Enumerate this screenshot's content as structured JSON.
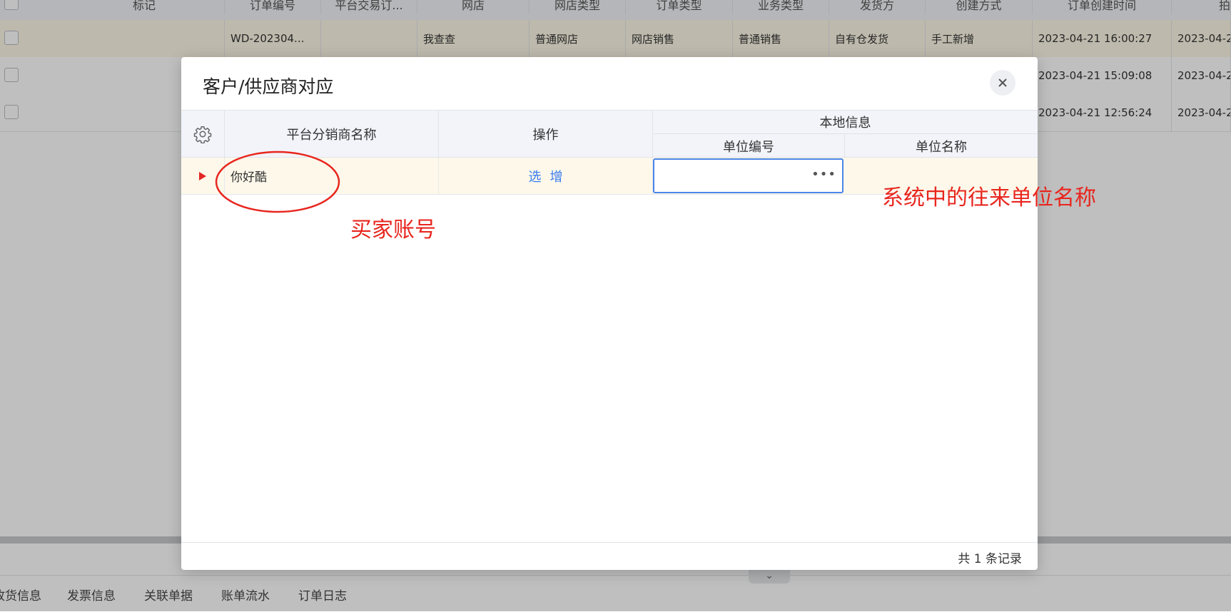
{
  "background": {
    "columns": [
      "标记",
      "订单编号",
      "平台交易订...",
      "网店",
      "网店类型",
      "订单类型",
      "业务类型",
      "发货方",
      "创建方式",
      "订单创建时间",
      "拍"
    ],
    "rows": [
      {
        "order_no": "WD-202304...",
        "platform_no": "",
        "shop": "我查查",
        "shop_type": "普通网店",
        "order_type": "网店销售",
        "biz_type": "普通销售",
        "shipper": "自有仓发货",
        "create_method": "手工新增",
        "created_at": "2023-04-21 16:00:27",
        "extra": "2023-04-2"
      },
      {
        "order_no": "",
        "platform_no": "",
        "shop": "",
        "shop_type": "",
        "order_type": "",
        "biz_type": "",
        "shipper": "",
        "create_method": "",
        "created_at": "2023-04-21 15:09:08",
        "extra": "2023-04-2"
      },
      {
        "order_no": "",
        "platform_no": "",
        "shop": "",
        "shop_type": "",
        "order_type": "",
        "biz_type": "",
        "shipper": "",
        "create_method": "",
        "created_at": "2023-04-21 12:56:24",
        "extra": "2023-04-2"
      }
    ],
    "bottom_tabs": [
      "收货信息",
      "发票信息",
      "关联单据",
      "账单流水",
      "订单日志"
    ]
  },
  "dialog": {
    "title": "客户/供应商对应",
    "close_icon": "close-icon",
    "settings_icon": "gear-icon",
    "columns": {
      "platform_name": "平台分销商名称",
      "operation": "操作",
      "local_info": "本地信息",
      "unit_code": "单位编号",
      "unit_name": "单位名称"
    },
    "row": {
      "platform_name": "你好酷",
      "action_select": "选",
      "action_add": "增",
      "unit_code": "",
      "unit_code_button": "•••",
      "unit_name": ""
    },
    "record_count": "共 1 条记录"
  },
  "annotations": {
    "buyer_account": "买家账号",
    "system_unit_name": "系统中的往来单位名称",
    "color": "#e8261e"
  }
}
